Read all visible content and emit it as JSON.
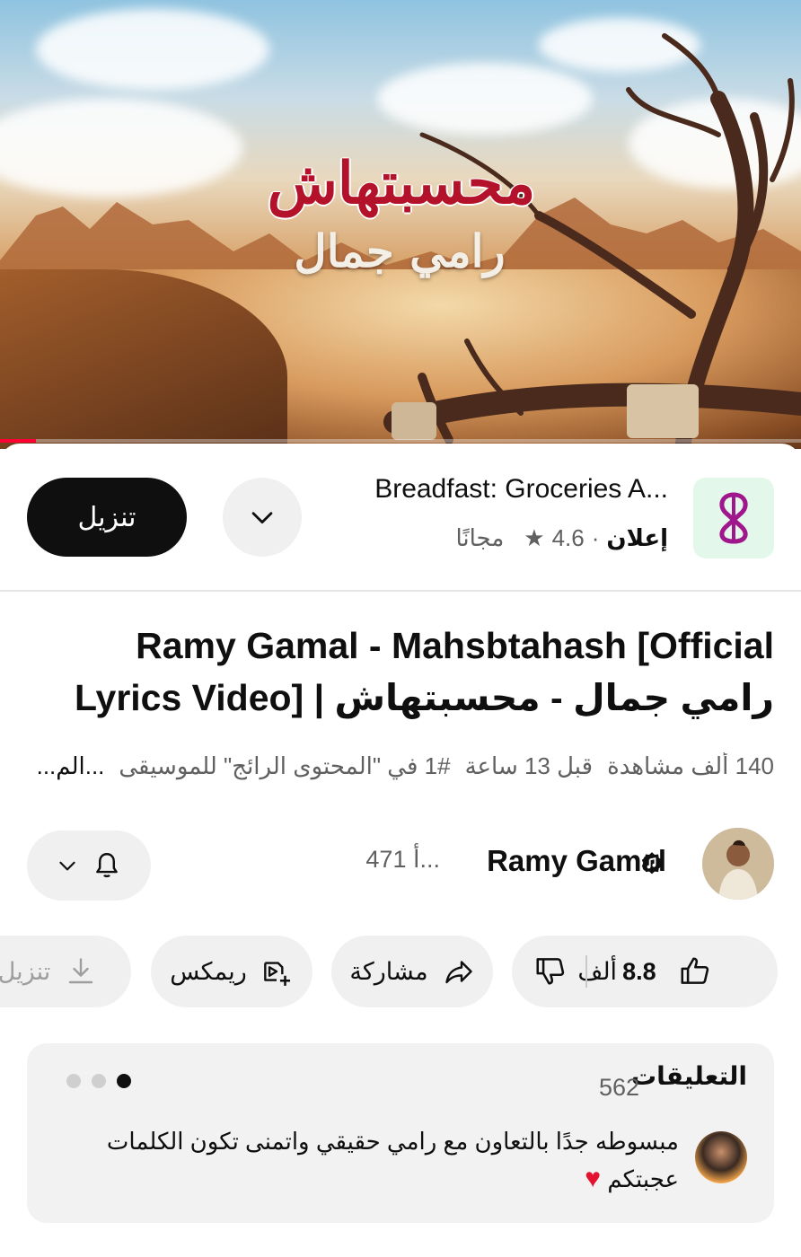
{
  "player": {
    "overlay_title": "محسبتهاش",
    "overlay_subtitle": "رامي جمال",
    "progress_fraction": 0.045,
    "progress_color": "#ff0033"
  },
  "ad": {
    "app_icon": "breadfast-logo-icon",
    "title": "Breadfast: Groceries A...",
    "badge": "إعلان",
    "rating": "4.6",
    "price": "مجانًا",
    "install_label": "تنزيل",
    "expand_icon": "chevron-down-icon"
  },
  "video": {
    "title": "Ramy Gamal - Mahsbtahash [Official Lyrics Video] | رامي جمال - محسبتهاش",
    "views": "140 ألف مشاهدة",
    "age": "قبل 13 ساعة",
    "trending": "#1 في \"المحتوى الرائج\" للموسيقى",
    "more": "...الم..."
  },
  "channel": {
    "name": "Ramy Gamal",
    "subscribers": "471 أ...",
    "verified_icon": "music-verified-icon",
    "bell_icon": "bell-icon"
  },
  "actions": {
    "likes": "8.8",
    "likes_unit": "ألف",
    "share_label": "مشاركة",
    "remix_label": "ريمكس",
    "download_label": "تنزيل"
  },
  "comments": {
    "title": "التعليقات",
    "count": "562",
    "top_comment": "مبسوطه جدًا بالتعاون مع رامي حقيقي واتمنى تكون الكلمات عجبتكم",
    "heart": "♥"
  },
  "colors": {
    "accent": "#ff0033",
    "brand_breadfast": "#a0168c",
    "chip_bg": "#f0f0f0",
    "text_secondary": "#606060"
  }
}
